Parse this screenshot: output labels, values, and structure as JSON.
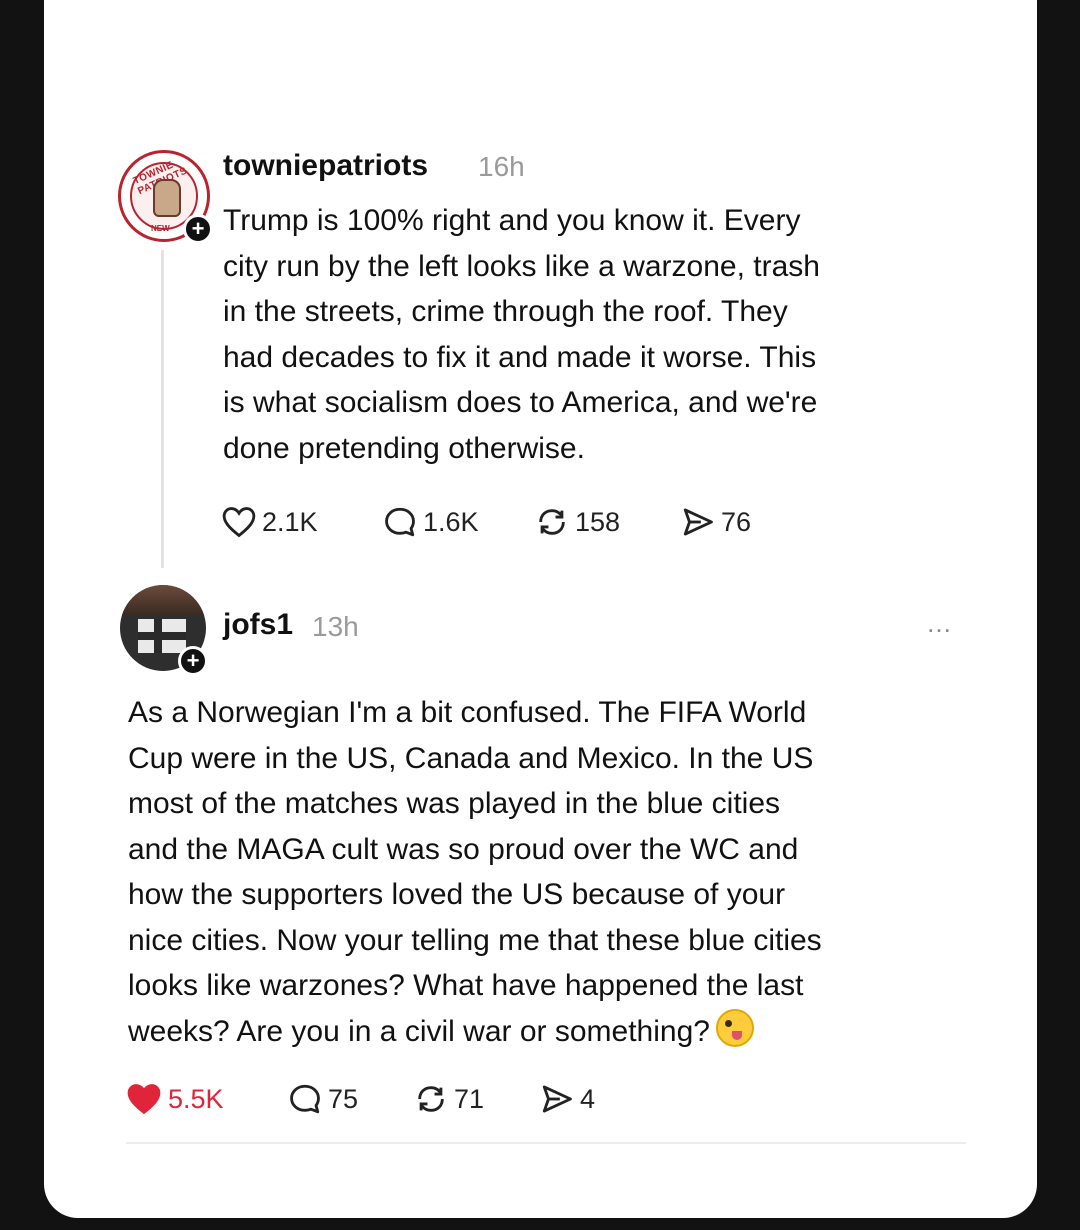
{
  "posts": [
    {
      "username": "towniepatriots",
      "timestamp": "16h",
      "avatar_text_top": "TOWNIE PATRIOTS",
      "avatar_text_bottom": "NEW",
      "text": "Trump is 100% right and you know it. Every\ncity run by the left looks like a warzone, trash\nin the streets, crime through the roof. They\nhad decades to fix it and made it worse. This\nis what socialism does to America, and we're\ndone pretending otherwise.",
      "likes": "2.1K",
      "replies": "1.6K",
      "reposts": "158",
      "shares": "76",
      "liked": false
    },
    {
      "username": "jofs1",
      "timestamp": "13h",
      "text": "As a Norwegian I'm a bit confused. The FIFA World\nCup were in the US, Canada and Mexico. In the US\nmost of the matches was played in the blue cities\nand the MAGA cult was so proud over the WC and\nhow the supporters loved the US because of your\nnice cities. Now your telling me that these blue cities\nlooks like warzones? What have happened the last\nweeks? Are you in a civil war or something?",
      "emoji": "zany-face-emoji",
      "likes": "5.5K",
      "replies": "75",
      "reposts": "71",
      "shares": "4",
      "liked": true
    }
  ],
  "icons": {
    "follow": "+",
    "more": "…"
  },
  "colors": {
    "like_active": "#e0243a",
    "text": "#111111",
    "muted": "#9a9a9a",
    "background": "#121212",
    "card": "#ffffff"
  }
}
